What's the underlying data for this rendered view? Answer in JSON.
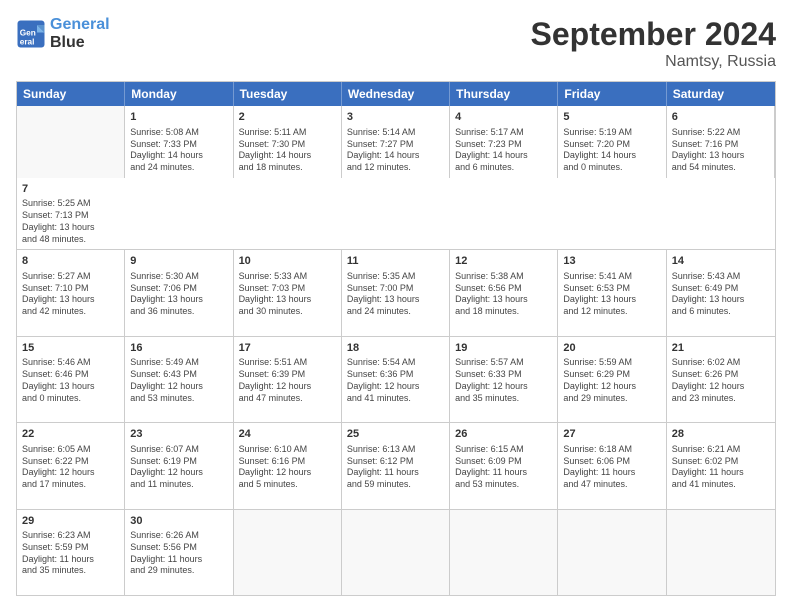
{
  "header": {
    "logo": {
      "line1": "General",
      "line2": "Blue"
    },
    "title": "September 2024",
    "location": "Namtsy, Russia"
  },
  "days": [
    "Sunday",
    "Monday",
    "Tuesday",
    "Wednesday",
    "Thursday",
    "Friday",
    "Saturday"
  ],
  "rows": [
    [
      {
        "day": "",
        "empty": true
      },
      {
        "day": "1",
        "line1": "Sunrise: 5:08 AM",
        "line2": "Sunset: 7:33 PM",
        "line3": "Daylight: 14 hours",
        "line4": "and 24 minutes."
      },
      {
        "day": "2",
        "line1": "Sunrise: 5:11 AM",
        "line2": "Sunset: 7:30 PM",
        "line3": "Daylight: 14 hours",
        "line4": "and 18 minutes."
      },
      {
        "day": "3",
        "line1": "Sunrise: 5:14 AM",
        "line2": "Sunset: 7:27 PM",
        "line3": "Daylight: 14 hours",
        "line4": "and 12 minutes."
      },
      {
        "day": "4",
        "line1": "Sunrise: 5:17 AM",
        "line2": "Sunset: 7:23 PM",
        "line3": "Daylight: 14 hours",
        "line4": "and 6 minutes."
      },
      {
        "day": "5",
        "line1": "Sunrise: 5:19 AM",
        "line2": "Sunset: 7:20 PM",
        "line3": "Daylight: 14 hours",
        "line4": "and 0 minutes."
      },
      {
        "day": "6",
        "line1": "Sunrise: 5:22 AM",
        "line2": "Sunset: 7:16 PM",
        "line3": "Daylight: 13 hours",
        "line4": "and 54 minutes."
      },
      {
        "day": "7",
        "line1": "Sunrise: 5:25 AM",
        "line2": "Sunset: 7:13 PM",
        "line3": "Daylight: 13 hours",
        "line4": "and 48 minutes."
      }
    ],
    [
      {
        "day": "8",
        "line1": "Sunrise: 5:27 AM",
        "line2": "Sunset: 7:10 PM",
        "line3": "Daylight: 13 hours",
        "line4": "and 42 minutes."
      },
      {
        "day": "9",
        "line1": "Sunrise: 5:30 AM",
        "line2": "Sunset: 7:06 PM",
        "line3": "Daylight: 13 hours",
        "line4": "and 36 minutes."
      },
      {
        "day": "10",
        "line1": "Sunrise: 5:33 AM",
        "line2": "Sunset: 7:03 PM",
        "line3": "Daylight: 13 hours",
        "line4": "and 30 minutes."
      },
      {
        "day": "11",
        "line1": "Sunrise: 5:35 AM",
        "line2": "Sunset: 7:00 PM",
        "line3": "Daylight: 13 hours",
        "line4": "and 24 minutes."
      },
      {
        "day": "12",
        "line1": "Sunrise: 5:38 AM",
        "line2": "Sunset: 6:56 PM",
        "line3": "Daylight: 13 hours",
        "line4": "and 18 minutes."
      },
      {
        "day": "13",
        "line1": "Sunrise: 5:41 AM",
        "line2": "Sunset: 6:53 PM",
        "line3": "Daylight: 13 hours",
        "line4": "and 12 minutes."
      },
      {
        "day": "14",
        "line1": "Sunrise: 5:43 AM",
        "line2": "Sunset: 6:49 PM",
        "line3": "Daylight: 13 hours",
        "line4": "and 6 minutes."
      }
    ],
    [
      {
        "day": "15",
        "line1": "Sunrise: 5:46 AM",
        "line2": "Sunset: 6:46 PM",
        "line3": "Daylight: 13 hours",
        "line4": "and 0 minutes."
      },
      {
        "day": "16",
        "line1": "Sunrise: 5:49 AM",
        "line2": "Sunset: 6:43 PM",
        "line3": "Daylight: 12 hours",
        "line4": "and 53 minutes."
      },
      {
        "day": "17",
        "line1": "Sunrise: 5:51 AM",
        "line2": "Sunset: 6:39 PM",
        "line3": "Daylight: 12 hours",
        "line4": "and 47 minutes."
      },
      {
        "day": "18",
        "line1": "Sunrise: 5:54 AM",
        "line2": "Sunset: 6:36 PM",
        "line3": "Daylight: 12 hours",
        "line4": "and 41 minutes."
      },
      {
        "day": "19",
        "line1": "Sunrise: 5:57 AM",
        "line2": "Sunset: 6:33 PM",
        "line3": "Daylight: 12 hours",
        "line4": "and 35 minutes."
      },
      {
        "day": "20",
        "line1": "Sunrise: 5:59 AM",
        "line2": "Sunset: 6:29 PM",
        "line3": "Daylight: 12 hours",
        "line4": "and 29 minutes."
      },
      {
        "day": "21",
        "line1": "Sunrise: 6:02 AM",
        "line2": "Sunset: 6:26 PM",
        "line3": "Daylight: 12 hours",
        "line4": "and 23 minutes."
      }
    ],
    [
      {
        "day": "22",
        "line1": "Sunrise: 6:05 AM",
        "line2": "Sunset: 6:22 PM",
        "line3": "Daylight: 12 hours",
        "line4": "and 17 minutes."
      },
      {
        "day": "23",
        "line1": "Sunrise: 6:07 AM",
        "line2": "Sunset: 6:19 PM",
        "line3": "Daylight: 12 hours",
        "line4": "and 11 minutes."
      },
      {
        "day": "24",
        "line1": "Sunrise: 6:10 AM",
        "line2": "Sunset: 6:16 PM",
        "line3": "Daylight: 12 hours",
        "line4": "and 5 minutes."
      },
      {
        "day": "25",
        "line1": "Sunrise: 6:13 AM",
        "line2": "Sunset: 6:12 PM",
        "line3": "Daylight: 11 hours",
        "line4": "and 59 minutes."
      },
      {
        "day": "26",
        "line1": "Sunrise: 6:15 AM",
        "line2": "Sunset: 6:09 PM",
        "line3": "Daylight: 11 hours",
        "line4": "and 53 minutes."
      },
      {
        "day": "27",
        "line1": "Sunrise: 6:18 AM",
        "line2": "Sunset: 6:06 PM",
        "line3": "Daylight: 11 hours",
        "line4": "and 47 minutes."
      },
      {
        "day": "28",
        "line1": "Sunrise: 6:21 AM",
        "line2": "Sunset: 6:02 PM",
        "line3": "Daylight: 11 hours",
        "line4": "and 41 minutes."
      }
    ],
    [
      {
        "day": "29",
        "line1": "Sunrise: 6:23 AM",
        "line2": "Sunset: 5:59 PM",
        "line3": "Daylight: 11 hours",
        "line4": "and 35 minutes."
      },
      {
        "day": "30",
        "line1": "Sunrise: 6:26 AM",
        "line2": "Sunset: 5:56 PM",
        "line3": "Daylight: 11 hours",
        "line4": "and 29 minutes."
      },
      {
        "day": "",
        "empty": true
      },
      {
        "day": "",
        "empty": true
      },
      {
        "day": "",
        "empty": true
      },
      {
        "day": "",
        "empty": true
      },
      {
        "day": "",
        "empty": true
      }
    ]
  ]
}
